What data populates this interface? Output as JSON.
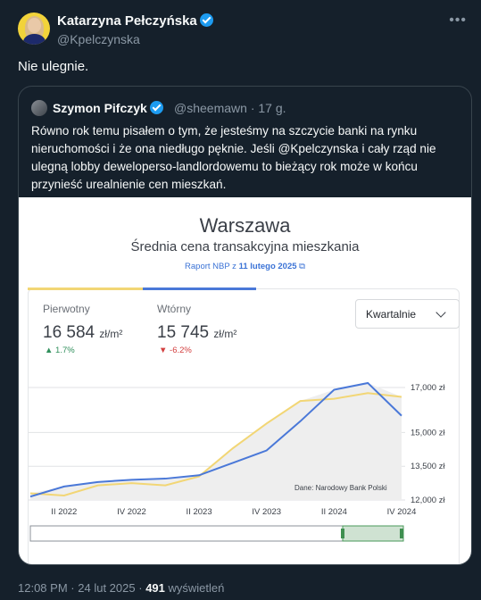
{
  "tweet": {
    "author_name": "Katarzyna Pełczyńska",
    "author_handle": "@Kpelczynska",
    "more_icon": "more-icon",
    "text": "Nie ulegnie.",
    "time": "12:08 PM",
    "date": "24 lut 2025",
    "separator": "·",
    "views_count": "491",
    "views_label": "wyświetleń"
  },
  "quote": {
    "author_name": "Szymon Pifczyk",
    "author_handle": "@sheemawn",
    "age": "· 17 g.",
    "text": "Równo rok temu pisałem o tym, że jesteśmy na szczycie banki na rynku nieruchomości i że ona niedługo pęknie. Jeśli @Kpelczynska i cały rząd nie ulegną lobby deweloperso-landlordowemu to bieżący rok może w końcu przynieść urealnienie cen mieszkań."
  },
  "chart_card": {
    "title": "Warszawa",
    "subtitle": "Średnia cena transakcyjna mieszkania",
    "link_prefix": "Raport NBP z ",
    "link_date": "11 lutego 2025",
    "stats": [
      {
        "label": "Pierwotny",
        "value": "16 584",
        "unit": "zł/m²",
        "change": "▲ 1.7%"
      },
      {
        "label": "Wtórny",
        "value": "15 745",
        "unit": "zł/m²",
        "change": "▼ -6.2%"
      }
    ],
    "period_select": "Kwartalnie",
    "source": "Dane: Narodowy Bank Polski"
  },
  "chart_data": {
    "type": "line",
    "title": "Warszawa",
    "subtitle": "Średnia cena transakcyjna mieszkania",
    "x": [
      "I 2022",
      "II 2022",
      "III 2022",
      "IV 2022",
      "I 2023",
      "II 2023",
      "III 2023",
      "IV 2023",
      "I 2024",
      "II 2024",
      "III 2024",
      "IV 2024"
    ],
    "x_tick_labels": [
      "II 2022",
      "IV 2022",
      "II 2023",
      "IV 2023",
      "II 2024",
      "IV 2024"
    ],
    "y_tick_labels": [
      "17,000 zł",
      "15,000 zł",
      "13,500 zł",
      "12,000 zł"
    ],
    "ylim": [
      12000,
      17000
    ],
    "series": [
      {
        "name": "Pierwotny",
        "color": "#f2d675",
        "values": [
          12300,
          12200,
          12650,
          12750,
          12650,
          13050,
          14300,
          15400,
          16400,
          16500,
          16750,
          16584
        ]
      },
      {
        "name": "Wtórny",
        "color": "#4a78d8",
        "values": [
          12150,
          12600,
          12800,
          12900,
          12950,
          13100,
          13650,
          14200,
          15500,
          16900,
          17200,
          15745
        ]
      }
    ],
    "grid": true,
    "legend": "top"
  },
  "colors": {
    "background": "#15202b",
    "verified": "#1d9bf0",
    "up": "#2f8f5b",
    "down": "#d34040"
  }
}
